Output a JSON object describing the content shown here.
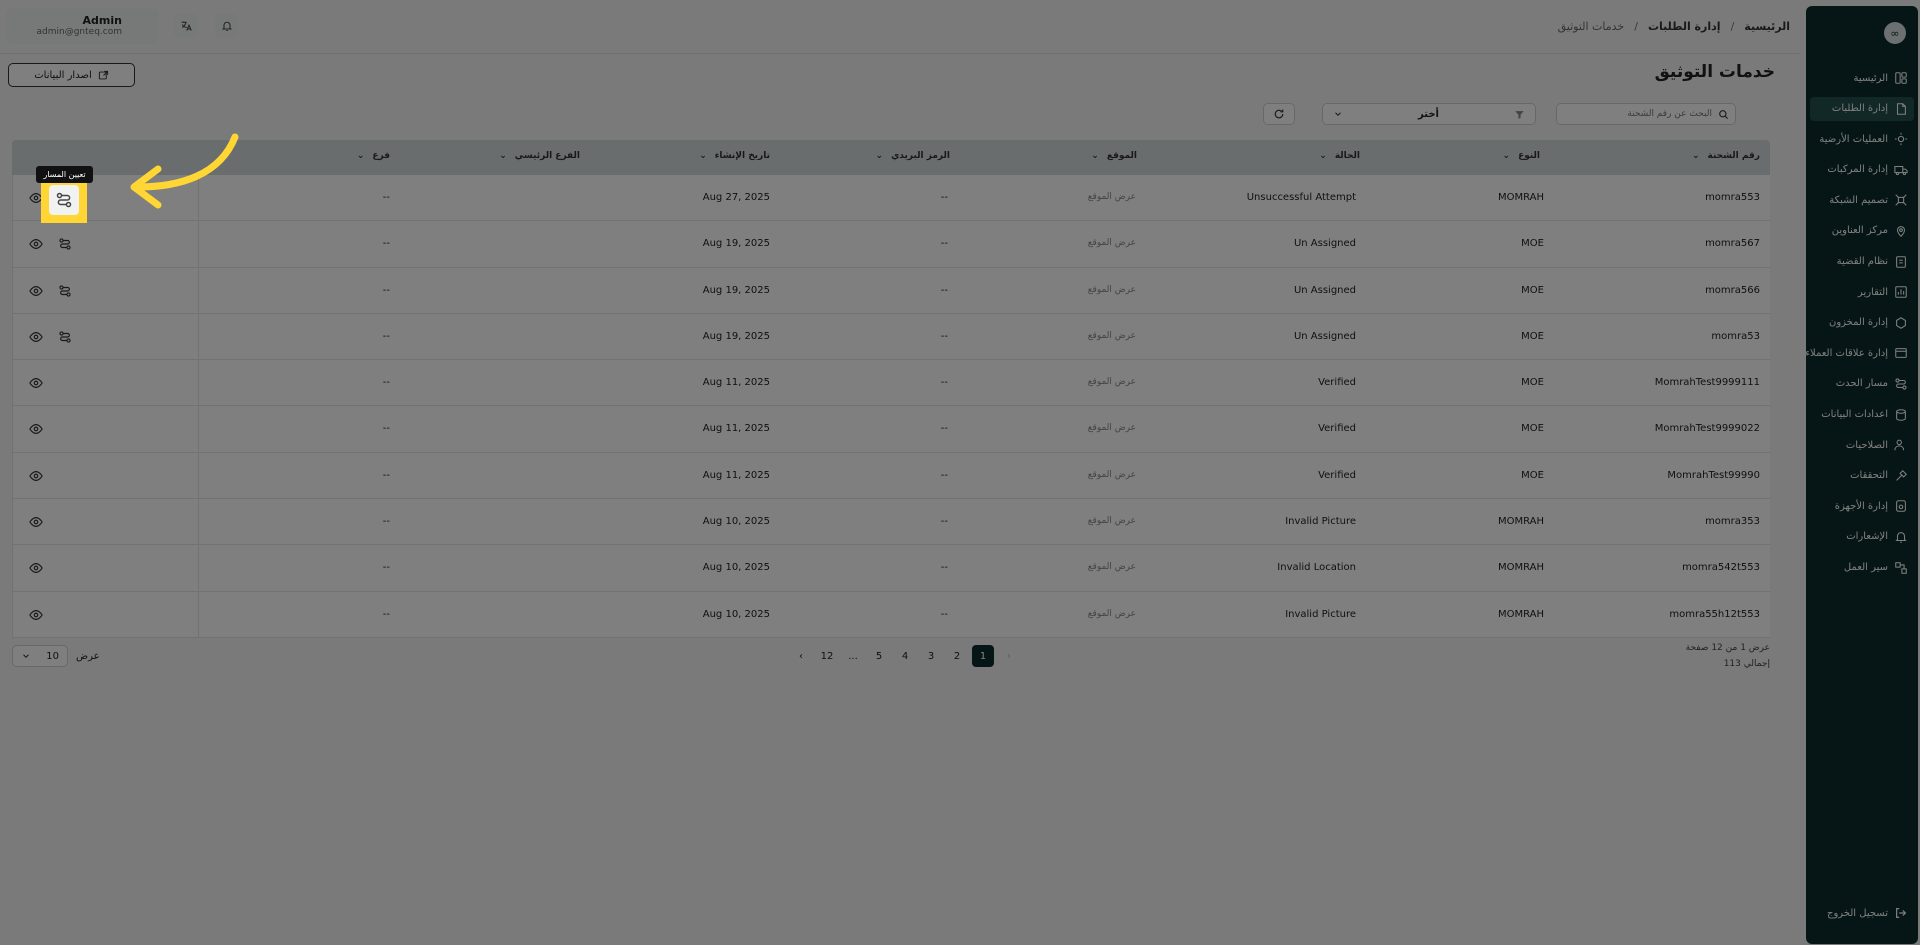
{
  "user": {
    "name": "Admin",
    "email": "admin@gnteq.com"
  },
  "breadcrumb": {
    "home": "الرئيسية",
    "section": "إدارة الطلبات",
    "current": "خدمات التوثيق",
    "sep": "/"
  },
  "page": {
    "title": "خدمات التوثيق",
    "export_label": "اصدار البيانات"
  },
  "filters": {
    "search_placeholder": "البحث عن رقم الشحنة",
    "select_label": "أختر"
  },
  "sidebar": {
    "logo": "∞",
    "items": [
      {
        "label": "الرئيسية",
        "icon": "home-icon"
      },
      {
        "label": "إدارة الطلبات",
        "icon": "orders-icon",
        "active": true
      },
      {
        "label": "العمليات الأرضية",
        "icon": "ground-ops-icon"
      },
      {
        "label": "إدارة المركبات",
        "icon": "truck-icon"
      },
      {
        "label": "تصميم الشبكة",
        "icon": "network-icon"
      },
      {
        "label": "مركز العناوين",
        "icon": "location-icon"
      },
      {
        "label": "نظام القضية",
        "icon": "case-icon"
      },
      {
        "label": "التقارير",
        "icon": "reports-icon"
      },
      {
        "label": "إدارة المخزون",
        "icon": "inventory-icon"
      },
      {
        "label": "إدارة علاقات العملاء",
        "icon": "crm-icon"
      },
      {
        "label": "مسار الحدث",
        "icon": "route-icon"
      },
      {
        "label": "اعدادات البيانات",
        "icon": "database-icon"
      },
      {
        "label": "الصلاحيات",
        "icon": "users-icon"
      },
      {
        "label": "التحققات",
        "icon": "tools-icon"
      },
      {
        "label": "إدارة الأجهزة",
        "icon": "devices-icon"
      },
      {
        "label": "الإشعارات",
        "icon": "bell-icon"
      },
      {
        "label": "سير العمل",
        "icon": "workflow-icon"
      }
    ],
    "logout": "تسجيل الخروج"
  },
  "table": {
    "headers": {
      "shipment": "رقم الشحنة",
      "type": "النوع",
      "status": "الحالة",
      "location": "الموقع",
      "postal": "الرمز البريدي",
      "created": "تاريخ الإنشاء",
      "main_branch": "الفرع الرئيسي",
      "branch": "فرع"
    },
    "rows": [
      {
        "shipment": "momra553",
        "type": "MOMRAH",
        "status": "Unsuccessful Attempt",
        "location": "عرض الموقع",
        "postal": "--",
        "created": "Aug 27, 2025",
        "branch": "--",
        "assign": true
      },
      {
        "shipment": "momra567",
        "type": "MOE",
        "status": "Un Assigned",
        "location": "عرض الموقع",
        "postal": "--",
        "created": "Aug 19, 2025",
        "branch": "--",
        "assign": true
      },
      {
        "shipment": "momra566",
        "type": "MOE",
        "status": "Un Assigned",
        "location": "عرض الموقع",
        "postal": "--",
        "created": "Aug 19, 2025",
        "branch": "--",
        "assign": true
      },
      {
        "shipment": "momra53",
        "type": "MOE",
        "status": "Un Assigned",
        "location": "عرض الموقع",
        "postal": "--",
        "created": "Aug 19, 2025",
        "branch": "--",
        "assign": true
      },
      {
        "shipment": "MomrahTest9999111",
        "type": "MOE",
        "status": "Verified",
        "location": "عرض الموقع",
        "postal": "--",
        "created": "Aug 11, 2025",
        "branch": "--",
        "assign": false
      },
      {
        "shipment": "MomrahTest9999022",
        "type": "MOE",
        "status": "Verified",
        "location": "عرض الموقع",
        "postal": "--",
        "created": "Aug 11, 2025",
        "branch": "--",
        "assign": false
      },
      {
        "shipment": "MomrahTest99990",
        "type": "MOE",
        "status": "Verified",
        "location": "عرض الموقع",
        "postal": "--",
        "created": "Aug 11, 2025",
        "branch": "--",
        "assign": false
      },
      {
        "shipment": "momra353",
        "type": "MOMRAH",
        "status": "Invalid Picture",
        "location": "عرض الموقع",
        "postal": "--",
        "created": "Aug 10, 2025",
        "branch": "--",
        "assign": false
      },
      {
        "shipment": "momra542t553",
        "type": "MOMRAH",
        "status": "Invalid Location",
        "location": "عرض الموقع",
        "postal": "--",
        "created": "Aug 10, 2025",
        "branch": "--",
        "assign": false
      },
      {
        "shipment": "momra55h12t553",
        "type": "MOMRAH",
        "status": "Invalid Picture",
        "location": "عرض الموقع",
        "postal": "--",
        "created": "Aug 10, 2025",
        "branch": "--",
        "assign": false
      }
    ]
  },
  "pagination": {
    "pages": [
      "1",
      "2",
      "3",
      "4",
      "5",
      "...",
      "12"
    ],
    "current": "1",
    "info": "عرض 1 من 12 صفحة",
    "total": "إجمالي 113",
    "per_page_label": "عرض",
    "per_page": "10"
  },
  "tooltip": "تعيين المسار",
  "colors": {
    "sidebar_bg": "#0d2d2c",
    "accent": "#ffd633"
  }
}
